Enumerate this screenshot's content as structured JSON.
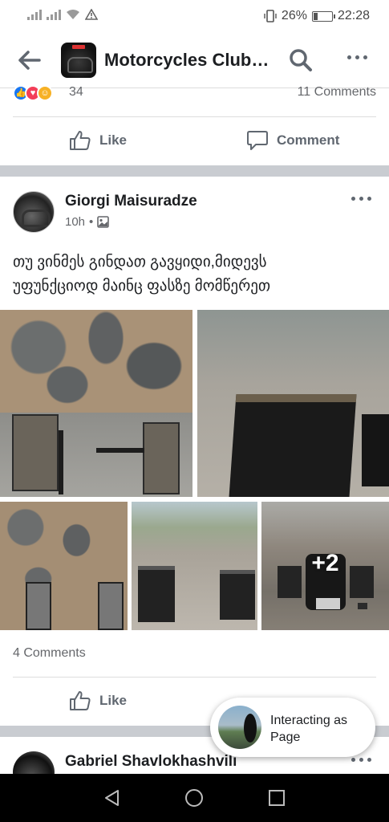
{
  "status_bar": {
    "battery": "26%",
    "battery_level": 0.26,
    "time": "22:28"
  },
  "header": {
    "title": "Motorcycles Club…",
    "back_icon": "arrow-left-icon",
    "search_icon": "search-icon",
    "more_icon": "more-horizontal-icon"
  },
  "previous_post": {
    "reaction_count": "34",
    "comments": "11 Comments",
    "like_label": "Like",
    "comment_label": "Comment"
  },
  "post": {
    "author": "Giorgi Maisuradze",
    "time": "10h",
    "separator": "•",
    "text_line1": "თუ ვინმეს გინდათ გავყიდი,მიდევს",
    "text_line2": "უფუნქციოდ მაინც ფასზე მომწერეთ",
    "more_photos": "+2",
    "comments": "4 Comments",
    "like_label": "Like"
  },
  "next_post": {
    "author": "Gabriel Shavlokhashvili"
  },
  "interacting": {
    "line1": "Interacting as",
    "line2": "Page"
  },
  "colors": {
    "facebook_blue": "#1877f2",
    "divider": "#c9ccd1",
    "secondary_text": "#65676b"
  }
}
